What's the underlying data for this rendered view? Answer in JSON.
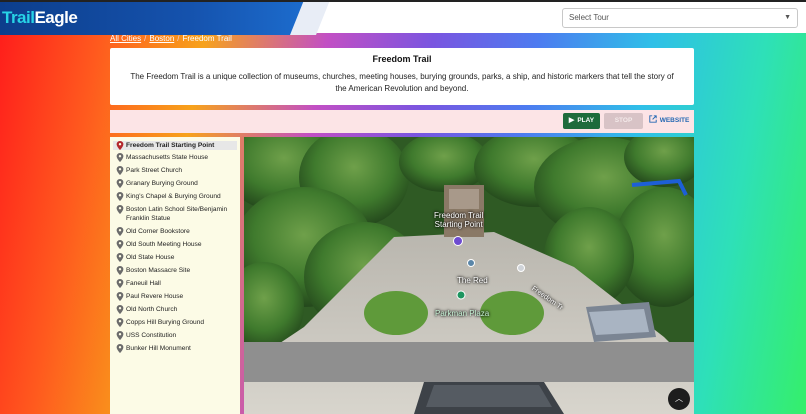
{
  "app": {
    "logo_part1": "Trail",
    "logo_part2": "Eagle",
    "select_placeholder": "Select Tour"
  },
  "breadcrumb": {
    "items": [
      "All Cities",
      "Boston",
      "Freedom Trail"
    ]
  },
  "tour": {
    "title": "Freedom Trail",
    "description": "The Freedom Trail is a unique collection of museums, churches, meeting houses, burying grounds, parks, a ship, and historic markers that tell the story of the American Revolution and beyond."
  },
  "controls": {
    "play_label": "PLAY",
    "stop_label": "STOP",
    "website_label": "WEBSITE"
  },
  "stops": [
    {
      "label": "Freedom Trail Starting Point",
      "active": true
    },
    {
      "label": "Massachusetts State House"
    },
    {
      "label": "Park Street Church"
    },
    {
      "label": "Granary Burying Ground"
    },
    {
      "label": "King's Chapel & Burying Ground"
    },
    {
      "label": "Boston Latin School Site/Benjamin Franklin Statue"
    },
    {
      "label": "Old Corner Bookstore"
    },
    {
      "label": "Old South Meeting House"
    },
    {
      "label": "Old State House"
    },
    {
      "label": "Boston Massacre Site"
    },
    {
      "label": "Faneuil Hall"
    },
    {
      "label": "Paul Revere House"
    },
    {
      "label": "Old North Church"
    },
    {
      "label": "Copps Hill Burying Ground"
    },
    {
      "label": "USS Constitution"
    },
    {
      "label": "Bunker Hill Monument"
    }
  ],
  "map": {
    "labels": {
      "start_line1": "Freedom Trail",
      "start_line2": "Starting Point",
      "the_red": "The Red",
      "parkman": "Parkman Plaza",
      "freedom_trail_road": "Freedom Tr"
    }
  },
  "colors": {
    "play": "#1e6b3b",
    "active_pin": "#b3262d",
    "pin": "#6b6b6b",
    "website_link": "#2569b3"
  }
}
